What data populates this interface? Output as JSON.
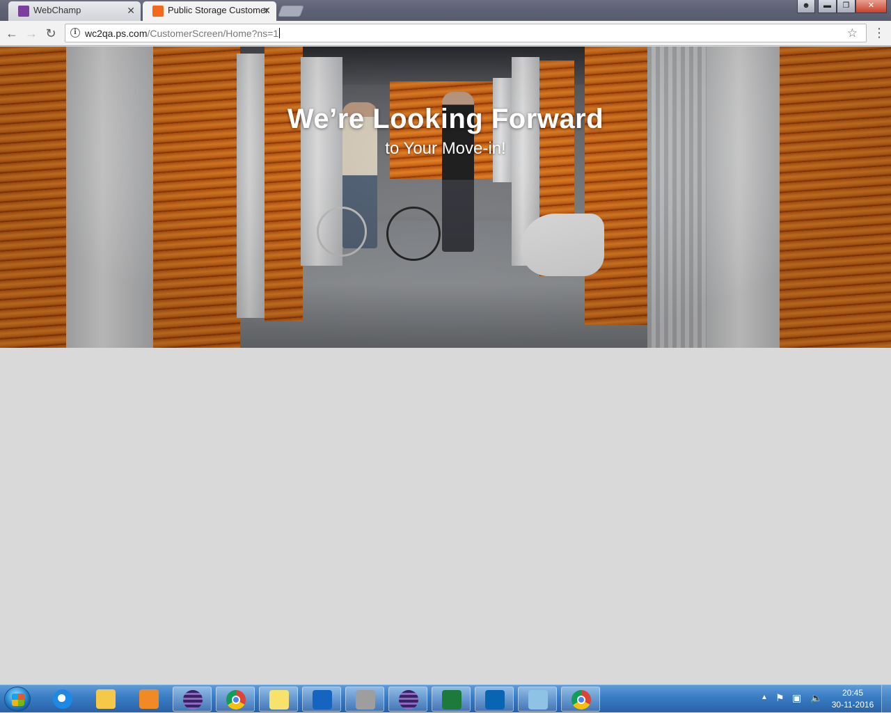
{
  "browser": {
    "tabs": [
      {
        "title": "WebChamp",
        "active": false,
        "favicon_color": "#7b3fa0"
      },
      {
        "title": "Public Storage Customer",
        "active": true,
        "favicon_color": "#f26a1b"
      }
    ],
    "url_host": "wc2qa.ps.com",
    "url_path": "/CustomerScreen/Home?ns=1"
  },
  "hero": {
    "title": "We’re Looking Forward",
    "subtitle": "to Your Move-in!"
  },
  "taskbar": {
    "apps": [
      {
        "name": "internet-explorer-icon",
        "color": "#1e88e5",
        "running": false
      },
      {
        "name": "file-explorer-icon",
        "color": "#f5c84a",
        "running": false
      },
      {
        "name": "media-player-icon",
        "color": "#f08a24",
        "running": false
      },
      {
        "name": "eclipse-icon",
        "color": "#5b3a8c",
        "running": true
      },
      {
        "name": "chrome-icon",
        "color": "#db4437",
        "running": true
      },
      {
        "name": "sticky-notes-icon",
        "color": "#f7e26b",
        "running": true
      },
      {
        "name": "lync-icon",
        "color": "#1565c0",
        "running": true
      },
      {
        "name": "tools-icon",
        "color": "#9e9e9e",
        "running": true
      },
      {
        "name": "eclipse-icon",
        "color": "#5b3a8c",
        "running": true
      },
      {
        "name": "excel-icon",
        "color": "#1d7a3b",
        "running": true
      },
      {
        "name": "outlook-icon",
        "color": "#0a64b4",
        "running": true
      },
      {
        "name": "notepad-icon",
        "color": "#8ec3e6",
        "running": true
      },
      {
        "name": "chrome-icon",
        "color": "#db4437",
        "running": true
      }
    ],
    "clock_time": "20:45",
    "clock_date": "30-11-2016"
  }
}
